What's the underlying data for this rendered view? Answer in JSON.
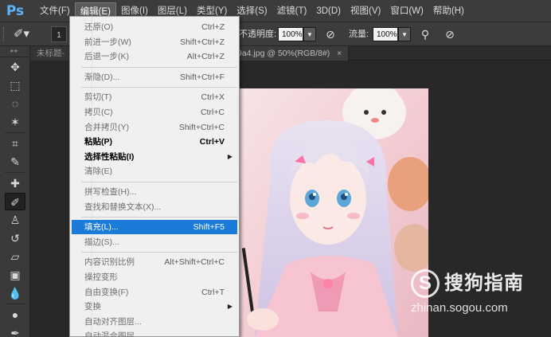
{
  "app": {
    "logo": "Ps"
  },
  "menubar": {
    "items": [
      {
        "label": "文件(F)"
      },
      {
        "label": "编辑(E)"
      },
      {
        "label": "图像(I)"
      },
      {
        "label": "图层(L)"
      },
      {
        "label": "类型(Y)"
      },
      {
        "label": "选择(S)"
      },
      {
        "label": "滤镜(T)"
      },
      {
        "label": "3D(D)"
      },
      {
        "label": "视图(V)"
      },
      {
        "label": "窗口(W)"
      },
      {
        "label": "帮助(H)"
      }
    ],
    "active_index": 1
  },
  "options": {
    "size_value": "1",
    "opacity_label": "不透明度:",
    "opacity_value": "100%",
    "flow_label": "流量:",
    "flow_value": "100%",
    "brush_icon": "brush-icon",
    "pressure_icon": "pressure-opacity-icon",
    "airbrush_icon": "airbrush-icon",
    "pressure_size_icon": "pressure-size-icon"
  },
  "tabs": [
    {
      "label": "未标题-"
    },
    {
      "label": "9a4.jpg @ 50%(RGB/8#)",
      "close": "×"
    }
  ],
  "toolbox": {
    "header": "▸▸",
    "tools": [
      {
        "name": "move-tool-icon",
        "glyph": "✥"
      },
      {
        "name": "marquee-tool-icon",
        "glyph": "⬚"
      },
      {
        "name": "lasso-tool-icon",
        "glyph": "◌"
      },
      {
        "name": "magic-wand-tool-icon",
        "glyph": "✶"
      },
      {
        "name": "crop-tool-icon",
        "glyph": "⌗"
      },
      {
        "name": "eyedropper-tool-icon",
        "glyph": "✎"
      },
      {
        "name": "healing-brush-tool-icon",
        "glyph": "✚"
      },
      {
        "name": "brush-tool-icon",
        "glyph": "✐",
        "active": true
      },
      {
        "name": "clone-stamp-tool-icon",
        "glyph": "♙"
      },
      {
        "name": "history-brush-tool-icon",
        "glyph": "↺"
      },
      {
        "name": "eraser-tool-icon",
        "glyph": "▱"
      },
      {
        "name": "gradient-tool-icon",
        "glyph": "▣"
      },
      {
        "name": "blur-tool-icon",
        "glyph": "💧"
      },
      {
        "name": "dodge-tool-icon",
        "glyph": "●"
      },
      {
        "name": "pen-tool-icon",
        "glyph": "✒"
      }
    ]
  },
  "edit_menu": {
    "items": [
      {
        "label": "还原(O)",
        "shortcut": "Ctrl+Z",
        "state": "disabled"
      },
      {
        "label": "前进一步(W)",
        "shortcut": "Shift+Ctrl+Z",
        "state": "disabled"
      },
      {
        "label": "后退一步(K)",
        "shortcut": "Alt+Ctrl+Z",
        "state": "disabled"
      },
      {
        "sep": true
      },
      {
        "label": "渐隐(D)...",
        "shortcut": "Shift+Ctrl+F",
        "state": "disabled"
      },
      {
        "sep": true
      },
      {
        "label": "剪切(T)",
        "shortcut": "Ctrl+X",
        "state": "disabled"
      },
      {
        "label": "拷贝(C)",
        "shortcut": "Ctrl+C",
        "state": "disabled"
      },
      {
        "label": "合并拷贝(Y)",
        "shortcut": "Shift+Ctrl+C",
        "state": "disabled"
      },
      {
        "label": "粘贴(P)",
        "shortcut": "Ctrl+V",
        "state": "enabled"
      },
      {
        "label": "选择性粘贴(I)",
        "shortcut": "",
        "state": "enabled",
        "submenu": true
      },
      {
        "label": "清除(E)",
        "shortcut": "",
        "state": "disabled"
      },
      {
        "sep": true
      },
      {
        "label": "拼写检查(H)...",
        "shortcut": "",
        "state": "disabled"
      },
      {
        "label": "查找和替换文本(X)...",
        "shortcut": "",
        "state": "disabled"
      },
      {
        "sep": true
      },
      {
        "label": "填充(L)...",
        "shortcut": "Shift+F5",
        "state": "highlighted"
      },
      {
        "label": "描边(S)...",
        "shortcut": "",
        "state": "disabled"
      },
      {
        "sep": true
      },
      {
        "label": "内容识别比例",
        "shortcut": "Alt+Shift+Ctrl+C",
        "state": "disabled"
      },
      {
        "label": "操控变形",
        "shortcut": "",
        "state": "disabled"
      },
      {
        "label": "自由变换(F)",
        "shortcut": "Ctrl+T",
        "state": "disabled"
      },
      {
        "label": "变换",
        "shortcut": "",
        "state": "disabled",
        "submenu": true
      },
      {
        "label": "自动对齐图层...",
        "shortcut": "",
        "state": "disabled"
      },
      {
        "label": "自动混合图层...",
        "shortcut": "",
        "state": "disabled"
      }
    ]
  },
  "watermark": {
    "logo": "S",
    "title": "搜狗指南",
    "url": "zhinan.sogou.com"
  },
  "colors": {
    "menu_highlight": "#1a7bd8",
    "ps_blue": "#5db2ff",
    "ui_dark": "#3c3c3c",
    "canvas_bg": "#282828"
  }
}
